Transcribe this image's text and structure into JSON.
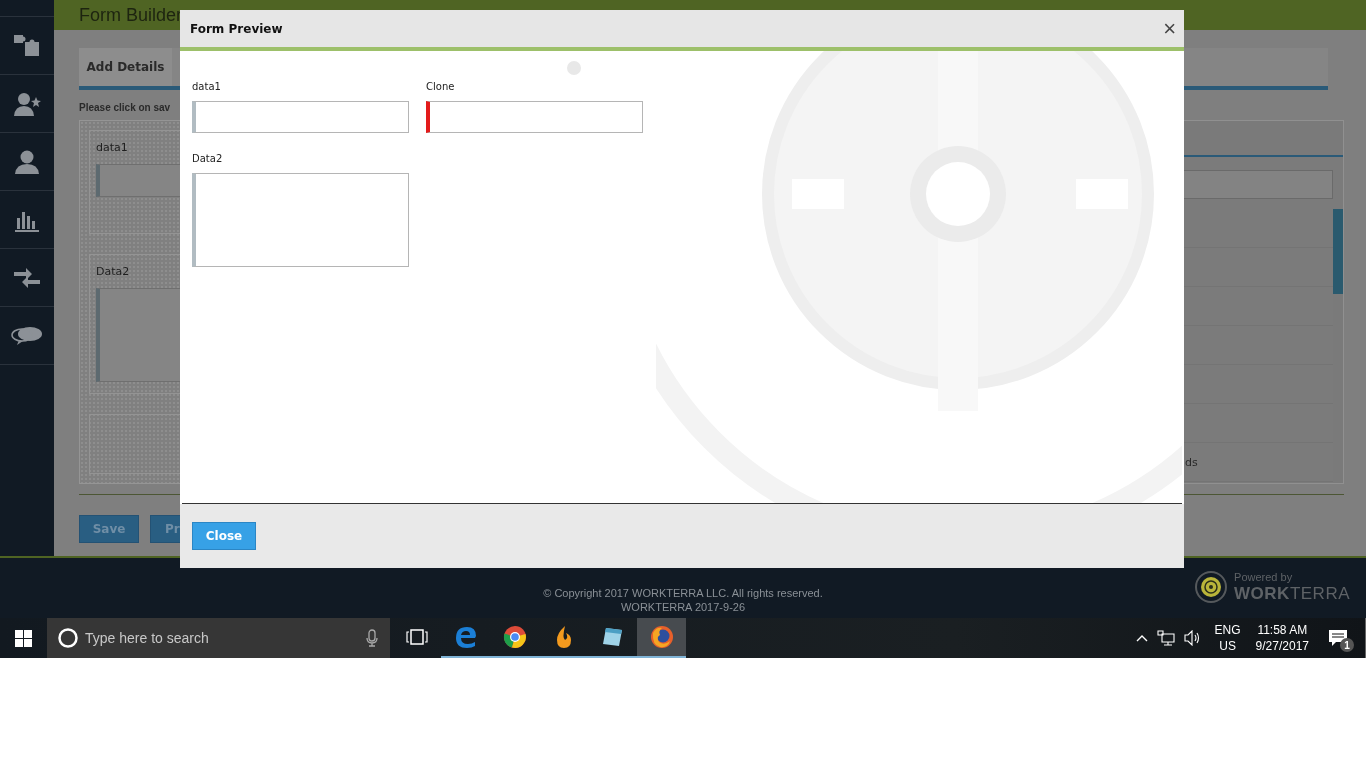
{
  "app": {
    "header_title": "Form Builder",
    "tabs": [
      {
        "label": "Add Details"
      }
    ],
    "instruction": "Please click on sav",
    "canvas_fields": [
      {
        "label": "data1",
        "kind": "input"
      },
      {
        "label": "Data2",
        "kind": "textarea"
      }
    ],
    "buttons": [
      "Save",
      "Pr"
    ],
    "side_panel": {
      "row_text": "ds"
    }
  },
  "modal": {
    "title": "Form Preview",
    "close_glyph": "×",
    "fields": [
      {
        "label": "data1",
        "kind": "input",
        "required": false
      },
      {
        "label": "Clone",
        "kind": "input",
        "required": true
      },
      {
        "label": "Data2",
        "kind": "textarea",
        "required": false
      }
    ],
    "buttons": [
      "Close"
    ]
  },
  "footer": {
    "copyright": "© Copyright 2017 WORKTERRA LLC. All rights reserved.",
    "build": "WORKTERRA 2017-9-26",
    "powered_by": "Powered by",
    "brand": "**WORK**TERRA"
  },
  "taskbar": {
    "search": {
      "placeholder": "Type here to search"
    },
    "apps": [
      {
        "kind": "task-view",
        "running": false,
        "selected": false
      },
      {
        "kind": "edge",
        "running": true,
        "selected": false
      },
      {
        "kind": "chrome",
        "running": true,
        "selected": false
      },
      {
        "kind": "flame",
        "running": true,
        "selected": false
      },
      {
        "kind": "notepad",
        "running": true,
        "selected": false
      },
      {
        "kind": "firefox",
        "running": true,
        "selected": true
      }
    ],
    "tray": {
      "language": "ENG",
      "region": "US",
      "time": "11:58 AM",
      "date": "9/27/2017",
      "notifications": "1"
    }
  }
}
